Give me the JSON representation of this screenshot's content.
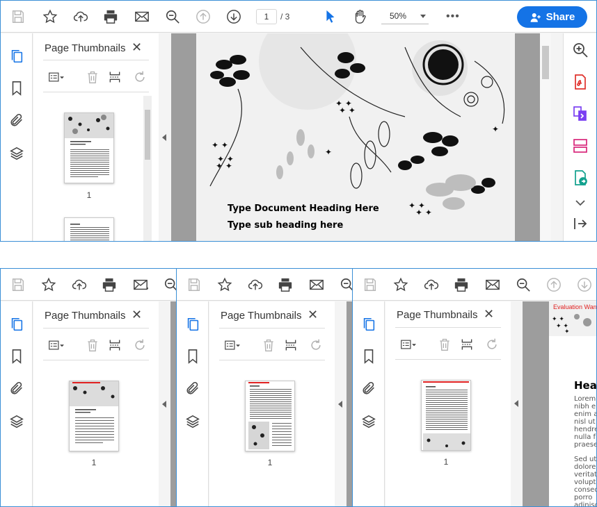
{
  "toolbar": {
    "icons": [
      "save-icon",
      "bookmark-star-icon",
      "upload-cloud-icon",
      "print-icon",
      "mail-icon",
      "zoom-search-icon",
      "page-up-icon",
      "page-down-icon",
      "select-cursor-icon",
      "hand-icon",
      "more-icon"
    ],
    "page_current": "1",
    "page_total": "/  3",
    "zoom_value": "50%",
    "more_label": "•••",
    "share_label": "Share"
  },
  "panel": {
    "title": "Page Thumbnails",
    "close_label": "✕",
    "page_label": "1"
  },
  "document": {
    "heading": "Type Document Heading Here",
    "subheading": "Type sub heading here"
  },
  "frame4": {
    "eval_text": "Evaluation Warning",
    "heading_partial": "Hea",
    "lorem_1": "Lorem\nnibh e\nenim a\nnisl ut\nhendre\nnulla f\npraese",
    "lorem_2": "Sed ut\ndolore\nveritat\nvolupta\nconseq\nporro\nadinisc"
  },
  "colors": {
    "accent": "#1473e6",
    "frame_border": "#3a8fd6",
    "doc_background": "#9d9d9d",
    "eval_red": "#e02020"
  }
}
